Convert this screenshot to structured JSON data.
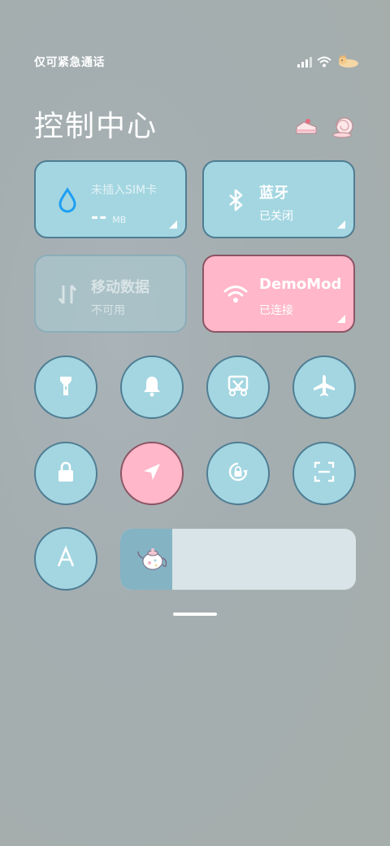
{
  "status": {
    "carrier": "仅可紧急通话",
    "icons": [
      "signal-icon",
      "wifi-icon",
      "shiba-dog-icon"
    ]
  },
  "title": "控制中心",
  "decorations": [
    "cake-icon",
    "snail-icon"
  ],
  "tiles": {
    "data_usage": {
      "line1": "未插入SIM卡",
      "value": "--",
      "unit": "MB",
      "icon": "water-drop-icon"
    },
    "bluetooth": {
      "title": "蓝牙",
      "status": "已关闭",
      "icon": "bluetooth-icon"
    },
    "mobile_data": {
      "title": "移动数据",
      "status": "不可用",
      "icon": "data-arrows-icon"
    },
    "wlan": {
      "title": "DemoMod",
      "status": "已连接",
      "icon": "wifi-icon"
    }
  },
  "toggles": [
    {
      "name": "flashlight",
      "icon": "flashlight-icon",
      "active": false
    },
    {
      "name": "silent",
      "icon": "bell-icon",
      "active": false
    },
    {
      "name": "screenshot",
      "icon": "scissors-icon",
      "active": false
    },
    {
      "name": "airplane",
      "icon": "airplane-icon",
      "active": false
    },
    {
      "name": "lock",
      "icon": "lock-icon",
      "active": false
    },
    {
      "name": "location",
      "icon": "location-arrow-icon",
      "active": true
    },
    {
      "name": "auto-rotate",
      "icon": "rotate-lock-icon",
      "active": false
    },
    {
      "name": "scanner",
      "icon": "scan-icon",
      "active": false
    },
    {
      "name": "reading-mode",
      "icon": "letter-a-icon",
      "active": false
    }
  ],
  "brightness": {
    "level": 0.22,
    "icon": "teapot-icon"
  },
  "colors": {
    "tile": "#a3d6e1",
    "active": "#ffb7c9",
    "border": "#4f7d93"
  }
}
